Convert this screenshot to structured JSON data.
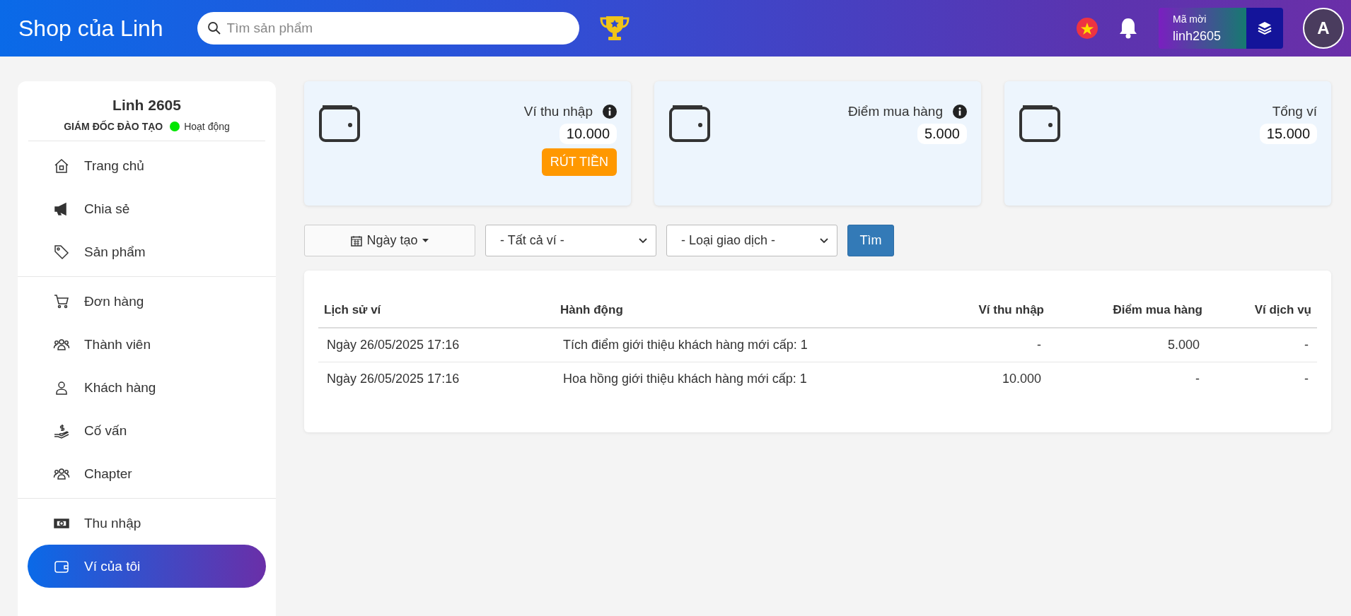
{
  "header": {
    "brand": "Shop của Linh",
    "search": {
      "placeholder": "Tìm sản phẩm"
    },
    "invite": {
      "label": "Mã mời",
      "code": "linh2605"
    },
    "avatar": "A"
  },
  "profile": {
    "name": "Linh 2605",
    "role": "GIÁM ĐỐC ĐÀO TẠO",
    "status": "Hoạt động"
  },
  "sidebar": {
    "sections": [
      {
        "items": [
          {
            "label": "Trang chủ",
            "kind": "home",
            "selected": false
          },
          {
            "label": "Chia sẻ",
            "kind": "megaphone",
            "selected": false
          },
          {
            "label": "Sản phẩm",
            "kind": "tag",
            "selected": false
          }
        ]
      },
      {
        "items": [
          {
            "label": "Đơn hàng",
            "kind": "cart",
            "selected": false
          },
          {
            "label": "Thành viên",
            "kind": "group",
            "selected": false
          },
          {
            "label": "Khách hàng",
            "kind": "user",
            "selected": false
          },
          {
            "label": "Cố vấn",
            "kind": "money",
            "selected": false
          },
          {
            "label": "Chapter",
            "kind": "group",
            "selected": false
          }
        ]
      },
      {
        "items": [
          {
            "label": "Thu nhập",
            "kind": "cash",
            "selected": false
          },
          {
            "label": "Ví của tôi",
            "kind": "wallet",
            "selected": true
          }
        ]
      }
    ]
  },
  "wallets": [
    {
      "title": "Ví thu nhập",
      "info": true,
      "amount": "10.000",
      "action": "RÚT TIỀN"
    },
    {
      "title": "Điểm mua hàng",
      "info": true,
      "amount": "5.000"
    },
    {
      "title": "Tổng ví",
      "info": false,
      "amount": "15.000"
    }
  ],
  "filters": {
    "date": "Ngày tạo",
    "wallet": "- Tất cả ví -",
    "type": "- Loại giao dịch -",
    "search": "Tìm"
  },
  "table": {
    "columns": [
      "Lịch sử ví",
      "Hành động",
      "Ví thu nhập",
      "Điểm mua hàng",
      "Ví dịch vụ"
    ],
    "rows": [
      [
        "Ngày 26/05/2025 17:16",
        "Tích điểm giới thiệu khách hàng mới cấp: 1",
        "-",
        "5.000",
        "-"
      ],
      [
        "Ngày 26/05/2025 17:16",
        "Hoa hồng giới thiệu khách hàng mới cấp: 1",
        "10.000",
        "-",
        "-"
      ]
    ]
  }
}
